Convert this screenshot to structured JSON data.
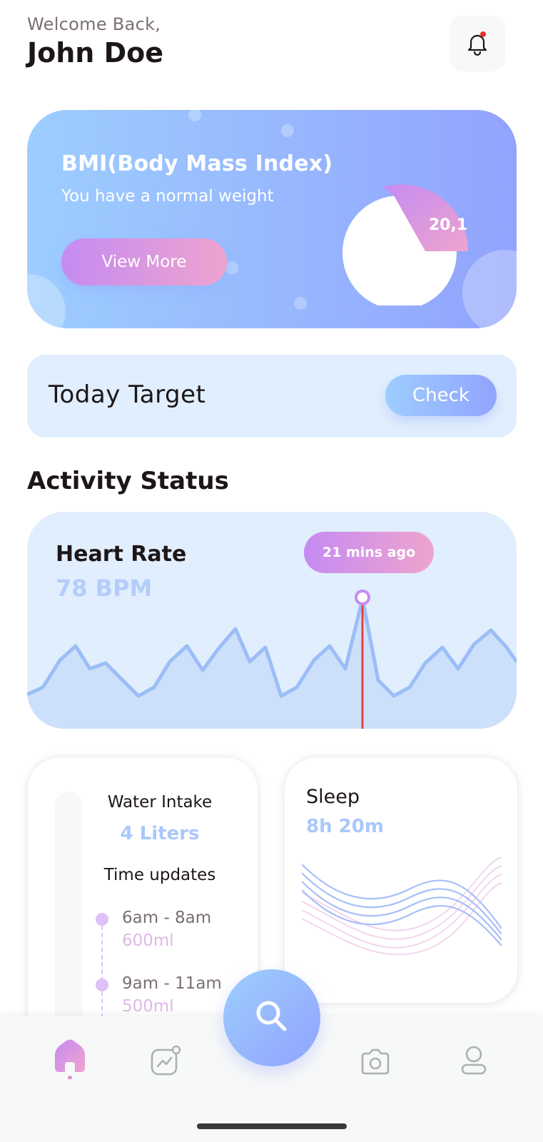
{
  "header": {
    "welcome": "Welcome Back,",
    "name": "John Doe",
    "notification_icon": "bell-icon"
  },
  "bmi": {
    "title": "BMI(Body Mass Index)",
    "subtitle": "You have a normal weight",
    "button": "View More",
    "value": "20,1"
  },
  "target": {
    "label": "Today Target",
    "button": "Check"
  },
  "activity": {
    "title": "Activity Status"
  },
  "heart_rate": {
    "title": "Heart Rate",
    "value": "78 BPM",
    "badge": "21 mins ago"
  },
  "water": {
    "title": "Water Intake",
    "value": "4 Liters",
    "updates_title": "Time updates",
    "fill_fraction": 0.06,
    "updates": [
      {
        "time": "6am - 8am",
        "amount": "600ml"
      },
      {
        "time": "9am - 11am",
        "amount": "500ml"
      }
    ]
  },
  "sleep": {
    "title": "Sleep",
    "value": "8h 20m"
  },
  "nav": {
    "items": [
      "home-icon",
      "activity-icon",
      "search-icon",
      "camera-icon",
      "profile-icon"
    ],
    "active": "home-icon"
  },
  "colors": {
    "blue_start": "#9dceff",
    "blue_end": "#92a3fd",
    "purple_start": "#c58bf2",
    "purple_end": "#eea4ce",
    "text": "#1d1617",
    "gray": "#7b6f72",
    "card_bg": "#e1eefd"
  }
}
